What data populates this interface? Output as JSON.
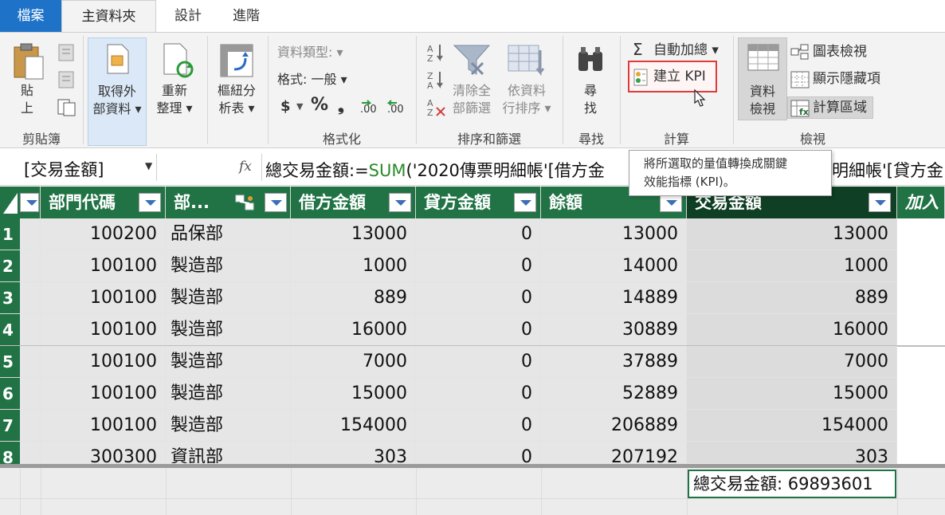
{
  "tabs": {
    "file": "檔案",
    "home": "主資料夾",
    "design": "設計",
    "advanced": "進階"
  },
  "ribbon": {
    "clipboard": {
      "paste": "貼\n上",
      "paste_l1": "貼",
      "paste_l2": "上",
      "label": "剪貼簿"
    },
    "get_external": {
      "l1": "取得外",
      "l2": "部資料 ▾"
    },
    "refresh": {
      "l1": "重新",
      "l2": "整理 ▾"
    },
    "pivot": {
      "l1": "樞紐分",
      "l2": "析表 ▾"
    },
    "format": {
      "data_type": "資料類型: ▾",
      "format": "格式: 一般 ▾",
      "currency": "$",
      "percent": "%",
      "comma": "❟",
      "label": "格式化"
    },
    "sort": {
      "clear_l1": "清除全",
      "clear_l2": "部篩選",
      "sortby_l1": "依資料",
      "sortby_l2": "行排序 ▾",
      "label": "排序和篩選"
    },
    "find": {
      "l1": "尋",
      "l2": "找",
      "label": "尋找"
    },
    "calc": {
      "autosum": "自動加總 ▾",
      "create_kpi": "建立 KPI",
      "label": "計算"
    },
    "view": {
      "data_view_l1": "資料",
      "data_view_l2": "檢視",
      "diagram": "圖表檢視",
      "show_hidden": "顯示隱藏項",
      "calc_area": "計算區域",
      "label": "檢視"
    }
  },
  "formula_bar": {
    "name_box": "[交易金額]",
    "fx": "fx",
    "formula_prefix": "總交易金額:=",
    "formula_fn": "SUM",
    "formula_rest": "('2020傳票明細帳'[借方金",
    "formula_tail": "明細帳'[貸方金"
  },
  "tooltip": {
    "line1": "將所選取的量值轉換成關鍵",
    "line2": "效能指標 (KPI)。"
  },
  "table": {
    "columns": [
      {
        "label": "部門代碼"
      },
      {
        "label": "部..."
      },
      {
        "label": "借方金額"
      },
      {
        "label": "貸方金額"
      },
      {
        "label": "餘額"
      },
      {
        "label": "交易金額"
      },
      {
        "label": "加入"
      }
    ],
    "rows": [
      {
        "n": "1",
        "dept": "100200",
        "name": "品保部",
        "debit": "13000",
        "credit": "0",
        "balance": "13000",
        "amount": "13000"
      },
      {
        "n": "2",
        "dept": "100100",
        "name": "製造部",
        "debit": "1000",
        "credit": "0",
        "balance": "14000",
        "amount": "1000"
      },
      {
        "n": "3",
        "dept": "100100",
        "name": "製造部",
        "debit": "889",
        "credit": "0",
        "balance": "14889",
        "amount": "889"
      },
      {
        "n": "4",
        "dept": "100100",
        "name": "製造部",
        "debit": "16000",
        "credit": "0",
        "balance": "30889",
        "amount": "16000"
      },
      {
        "n": "5",
        "dept": "100100",
        "name": "製造部",
        "debit": "7000",
        "credit": "0",
        "balance": "37889",
        "amount": "7000"
      },
      {
        "n": "6",
        "dept": "100100",
        "name": "製造部",
        "debit": "15000",
        "credit": "0",
        "balance": "52889",
        "amount": "15000"
      },
      {
        "n": "7",
        "dept": "100100",
        "name": "製造部",
        "debit": "154000",
        "credit": "0",
        "balance": "206889",
        "amount": "154000"
      },
      {
        "n": "8",
        "dept": "300300",
        "name": "資訊部",
        "debit": "303",
        "credit": "0",
        "balance": "207192",
        "amount": "303"
      }
    ],
    "measure": "總交易金額: 69893601"
  },
  "colors": {
    "header_green": "#217346",
    "selected_header": "#0f3f24",
    "file_tab": "#1e73c8",
    "kpi_highlight": "#e03a3a",
    "formula_fn": "#2a8a2a"
  }
}
